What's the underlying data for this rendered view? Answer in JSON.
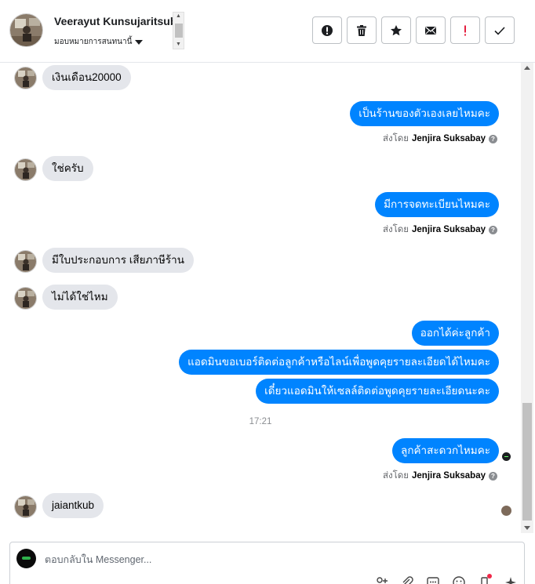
{
  "header": {
    "contact_name": "Veerayut Kunsujaritsub",
    "assign_label": "มอบหมายการสนทนานี้",
    "actions": [
      {
        "name": "mark-spam-button",
        "icon": "alert-circle-icon"
      },
      {
        "name": "delete-button",
        "icon": "trash-icon"
      },
      {
        "name": "star-button",
        "icon": "star-icon"
      },
      {
        "name": "mark-unread-button",
        "icon": "envelope-icon"
      },
      {
        "name": "important-button",
        "icon": "exclamation-icon"
      },
      {
        "name": "mark-done-button",
        "icon": "check-icon"
      }
    ]
  },
  "messages": [
    {
      "dir": "in",
      "text": "เงินเดือน20000"
    },
    {
      "dir": "out",
      "text": "เป็นร้านของตัวเองเลยไหมคะ"
    },
    {
      "dir": "sentby",
      "prefix": "ส่งโดย",
      "sender": "Jenjira Suksabay"
    },
    {
      "dir": "in",
      "text": "ใช่ครับ"
    },
    {
      "dir": "out",
      "text": "มีการจดทะเบียนไหมคะ"
    },
    {
      "dir": "sentby",
      "prefix": "ส่งโดย",
      "sender": "Jenjira Suksabay"
    },
    {
      "dir": "in",
      "text": "มีใบประกอบการ เสียภาษีร้าน"
    },
    {
      "dir": "in",
      "text": "ไม่ได้ใช่ไหม"
    },
    {
      "dir": "out",
      "text": "ออกได้ค่ะลูกค้า"
    },
    {
      "dir": "out",
      "text": "แอดมินขอเบอร์ติดต่อลูกค้าหรือไลน์เพื่อพูดคุยรายละเอียดได้ไหมคะ"
    },
    {
      "dir": "out",
      "text": "เดี๋ยวแอดมินให้เซลล์ติดต่อพูดคุยรายละเอียดนะคะ"
    },
    {
      "dir": "time",
      "text": "17:21"
    },
    {
      "dir": "out",
      "text": "ลูกค้าสะดวกไหมคะ"
    },
    {
      "dir": "sentby",
      "prefix": "ส่งโดย",
      "sender": "Jenjira Suksabay"
    },
    {
      "dir": "in",
      "text": "jaiantkub"
    }
  ],
  "composer": {
    "placeholder": "ตอบกลับใน Messenger...",
    "tools": [
      "add-person-icon",
      "attachment-icon",
      "saved-replies-icon",
      "emoji-icon",
      "notification-icon",
      "sparkle-icon"
    ]
  }
}
